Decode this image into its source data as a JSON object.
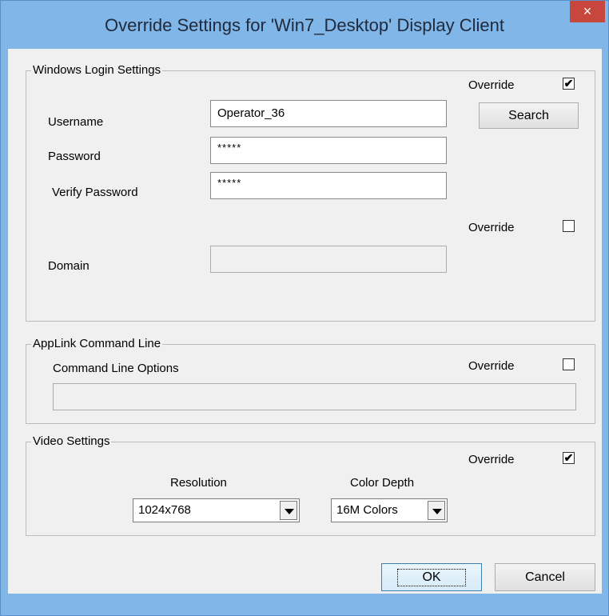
{
  "window": {
    "title": "Override Settings for 'Win7_Desktop' Display Client",
    "close": "×"
  },
  "login": {
    "legend": "Windows Login Settings",
    "override_label": "Override",
    "override_check": "✔",
    "username_label": "Username",
    "username_value": "Operator_36",
    "search_label": "Search",
    "password_label": "Password",
    "password_value": "*****",
    "verify_label": "Verify Password",
    "verify_value": "*****",
    "domain_override_label": "Override",
    "domain_label": "Domain",
    "domain_value": ""
  },
  "applink": {
    "legend": "AppLink Command Line",
    "options_label": "Command Line Options",
    "override_label": "Override",
    "value": ""
  },
  "video": {
    "legend": "Video Settings",
    "override_label": "Override",
    "override_check": "✔",
    "resolution_label": "Resolution",
    "resolution_value": "1024x768",
    "depth_label": "Color Depth",
    "depth_value": "16M Colors"
  },
  "buttons": {
    "ok": "OK",
    "cancel": "Cancel"
  }
}
